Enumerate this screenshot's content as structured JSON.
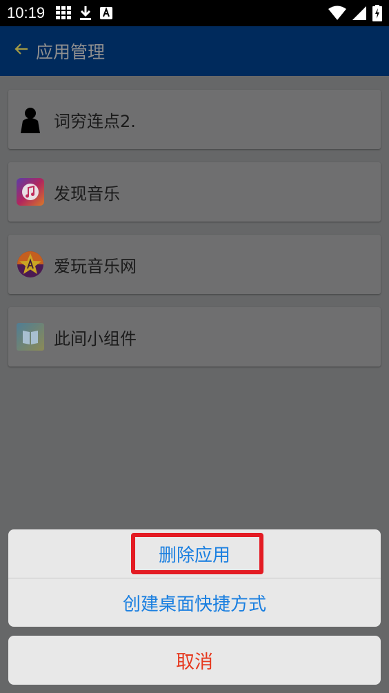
{
  "status_bar": {
    "time": "10:19"
  },
  "toolbar": {
    "title": "应用管理"
  },
  "apps": [
    {
      "name": "词穷连点2.",
      "icon": "silhouette-app-icon"
    },
    {
      "name": "发现音乐",
      "icon": "music-app-icon"
    },
    {
      "name": "爱玩音乐网",
      "icon": "star-music-app-icon"
    },
    {
      "name": "此间小组件",
      "icon": "book-widget-app-icon"
    }
  ],
  "action_sheet": {
    "delete_label": "删除应用",
    "shortcut_label": "创建桌面快捷方式",
    "cancel_label": "取消"
  },
  "colors": {
    "toolbar_bg": "#002a5c",
    "action_text": "#1a7fe0",
    "cancel_text": "#e6391f",
    "highlight_border": "#e31b23"
  }
}
